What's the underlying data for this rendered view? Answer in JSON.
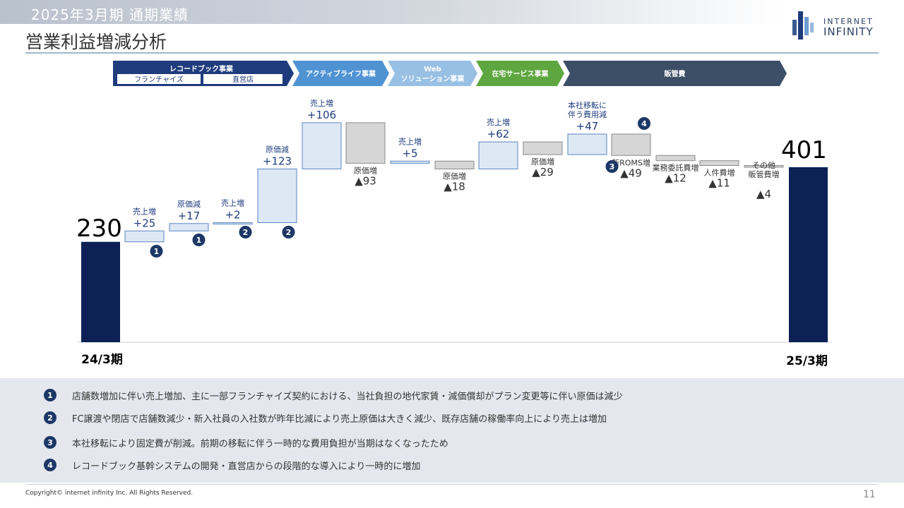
{
  "header": {
    "subtitle": "2025年3月期  通期業績",
    "title": "営業利益増減分析"
  },
  "logo": {
    "line1": "INTERNET",
    "line2": "INFINITY"
  },
  "colors": {
    "navy": "#0d2157",
    "increase_fill": "#dde8f5",
    "increase_border": "#5b86c2",
    "decrease_fill": "#d6d6d6",
    "decrease_border": "#8a8a8a",
    "seg_blue_dark": "#1f3c7d",
    "seg_blue": "#5093d3",
    "seg_blue_light": "#98c0e4",
    "seg_green": "#5ea63f",
    "seg_slate": "#3d4f66",
    "marker": "#1d3866"
  },
  "segments": [
    {
      "label": "レコードブック事業",
      "sub": [
        "フランチャイズ",
        "直営店"
      ]
    },
    {
      "label": "アクティブライフ事業"
    },
    {
      "label": "Web",
      "label2": "ソリューション事業"
    },
    {
      "label": "在宅サービス事業"
    },
    {
      "label": "販管費"
    }
  ],
  "chart_data": {
    "type": "waterfall",
    "unit": "",
    "start": {
      "label": "24/3期",
      "value": 230
    },
    "end": {
      "label": "25/3期",
      "value": 401
    },
    "steps": [
      {
        "label": "売上増",
        "value_label": "+25",
        "value": 25,
        "marker": "❶"
      },
      {
        "label": "原価減",
        "value_label": "+17",
        "value": 17,
        "marker": "❶"
      },
      {
        "label": "売上増",
        "value_label": "+2",
        "value": 2,
        "marker": "❷"
      },
      {
        "label": "原価減",
        "value_label": "+123",
        "value": 123,
        "marker": "❷"
      },
      {
        "label": "売上増",
        "value_label": "+106",
        "value": 106
      },
      {
        "label": "原価増",
        "value_label": "▲93",
        "value": -93
      },
      {
        "label": "売上増",
        "value_label": "+5",
        "value": 5
      },
      {
        "label": "原価増",
        "value_label": "▲18",
        "value": -18
      },
      {
        "label": "売上増",
        "value_label": "+62",
        "value": 62
      },
      {
        "label": "原価増",
        "value_label": "▲29",
        "value": -29
      },
      {
        "label": "本社移転に\n伴う費用減",
        "value_label": "+47",
        "value": 47
      },
      {
        "label": "新ROMS増",
        "value_label": "▲49",
        "value": -49,
        "marker": "❸"
      },
      {
        "label": "業務委託費増",
        "value_label": "▲12",
        "value": -12
      },
      {
        "label": "人件費増",
        "value_label": "▲11",
        "value": -11
      },
      {
        "label": "その他\n販管費増",
        "value_label": "▲4",
        "value": -4
      }
    ],
    "extra_markers": [
      {
        "after_step": 11,
        "marker": "❹"
      }
    ]
  },
  "notes": [
    {
      "num": "1",
      "text": "店舗数増加に伴い売上増加、主に一部フランチャイズ契約における、当社負担の地代家賃・減価償却がプラン変更等に伴い原価は減少"
    },
    {
      "num": "2",
      "text": "FC譲渡や閉店で店舗数減少・新入社員の入社数が昨年比減により売上原価は大きく減少、既存店舗の稼働率向上により売上は増加"
    },
    {
      "num": "3",
      "text": "本社移転により固定費が削減。前期の移転に伴う一時的な費用負担が当期はなくなったため"
    },
    {
      "num": "4",
      "text": "レコードブック基幹システムの開発・直営店からの段階的な導入により一時的に増加"
    }
  ],
  "footer": {
    "copyright": "Copyright© internet infinity Inc. All Rights Reserved.",
    "page": "11"
  }
}
